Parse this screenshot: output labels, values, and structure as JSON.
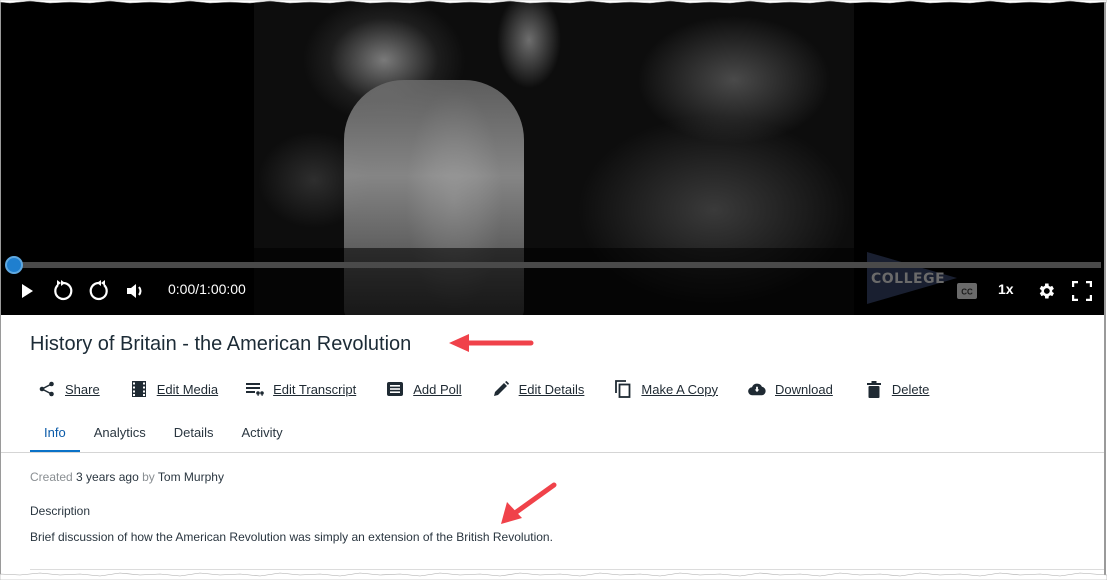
{
  "player": {
    "time_display": "0:00/1:00:00",
    "progress_fraction": 0.0,
    "speed_label": "1x",
    "cc_label": "CC",
    "watermark_text": "COLLEGE",
    "controls": [
      {
        "name": "play",
        "icon": "play-icon"
      },
      {
        "name": "rewind",
        "icon": "rewind-icon"
      },
      {
        "name": "forward",
        "icon": "forward-icon"
      },
      {
        "name": "volume",
        "icon": "volume-icon"
      }
    ],
    "accent_color": "#1f7fcf"
  },
  "media": {
    "title": "History of Britain - the American Revolution"
  },
  "actions": [
    {
      "label": "Share",
      "icon": "share-icon"
    },
    {
      "label": "Edit Media",
      "icon": "film-icon"
    },
    {
      "label": "Edit Transcript",
      "icon": "transcript-icon"
    },
    {
      "label": "Add Poll",
      "icon": "poll-icon"
    },
    {
      "label": "Edit Details",
      "icon": "pencil-icon"
    },
    {
      "label": "Make A Copy",
      "icon": "copy-icon"
    },
    {
      "label": "Download",
      "icon": "cloud-download-icon"
    },
    {
      "label": "Delete",
      "icon": "trash-icon"
    }
  ],
  "tabs": [
    {
      "label": "Info",
      "active": true
    },
    {
      "label": "Analytics",
      "active": false
    },
    {
      "label": "Details",
      "active": false
    },
    {
      "label": "Activity",
      "active": false
    }
  ],
  "info": {
    "created_prefix": "Created",
    "created_ago": "3 years ago",
    "created_by_word": "by",
    "author": "Tom Murphy",
    "description_label": "Description",
    "description": "Brief discussion of how the American Revolution was simply an extension of the British Revolution."
  },
  "annotation_color": "#f0424a",
  "tab_accent_color": "#0a72c8"
}
